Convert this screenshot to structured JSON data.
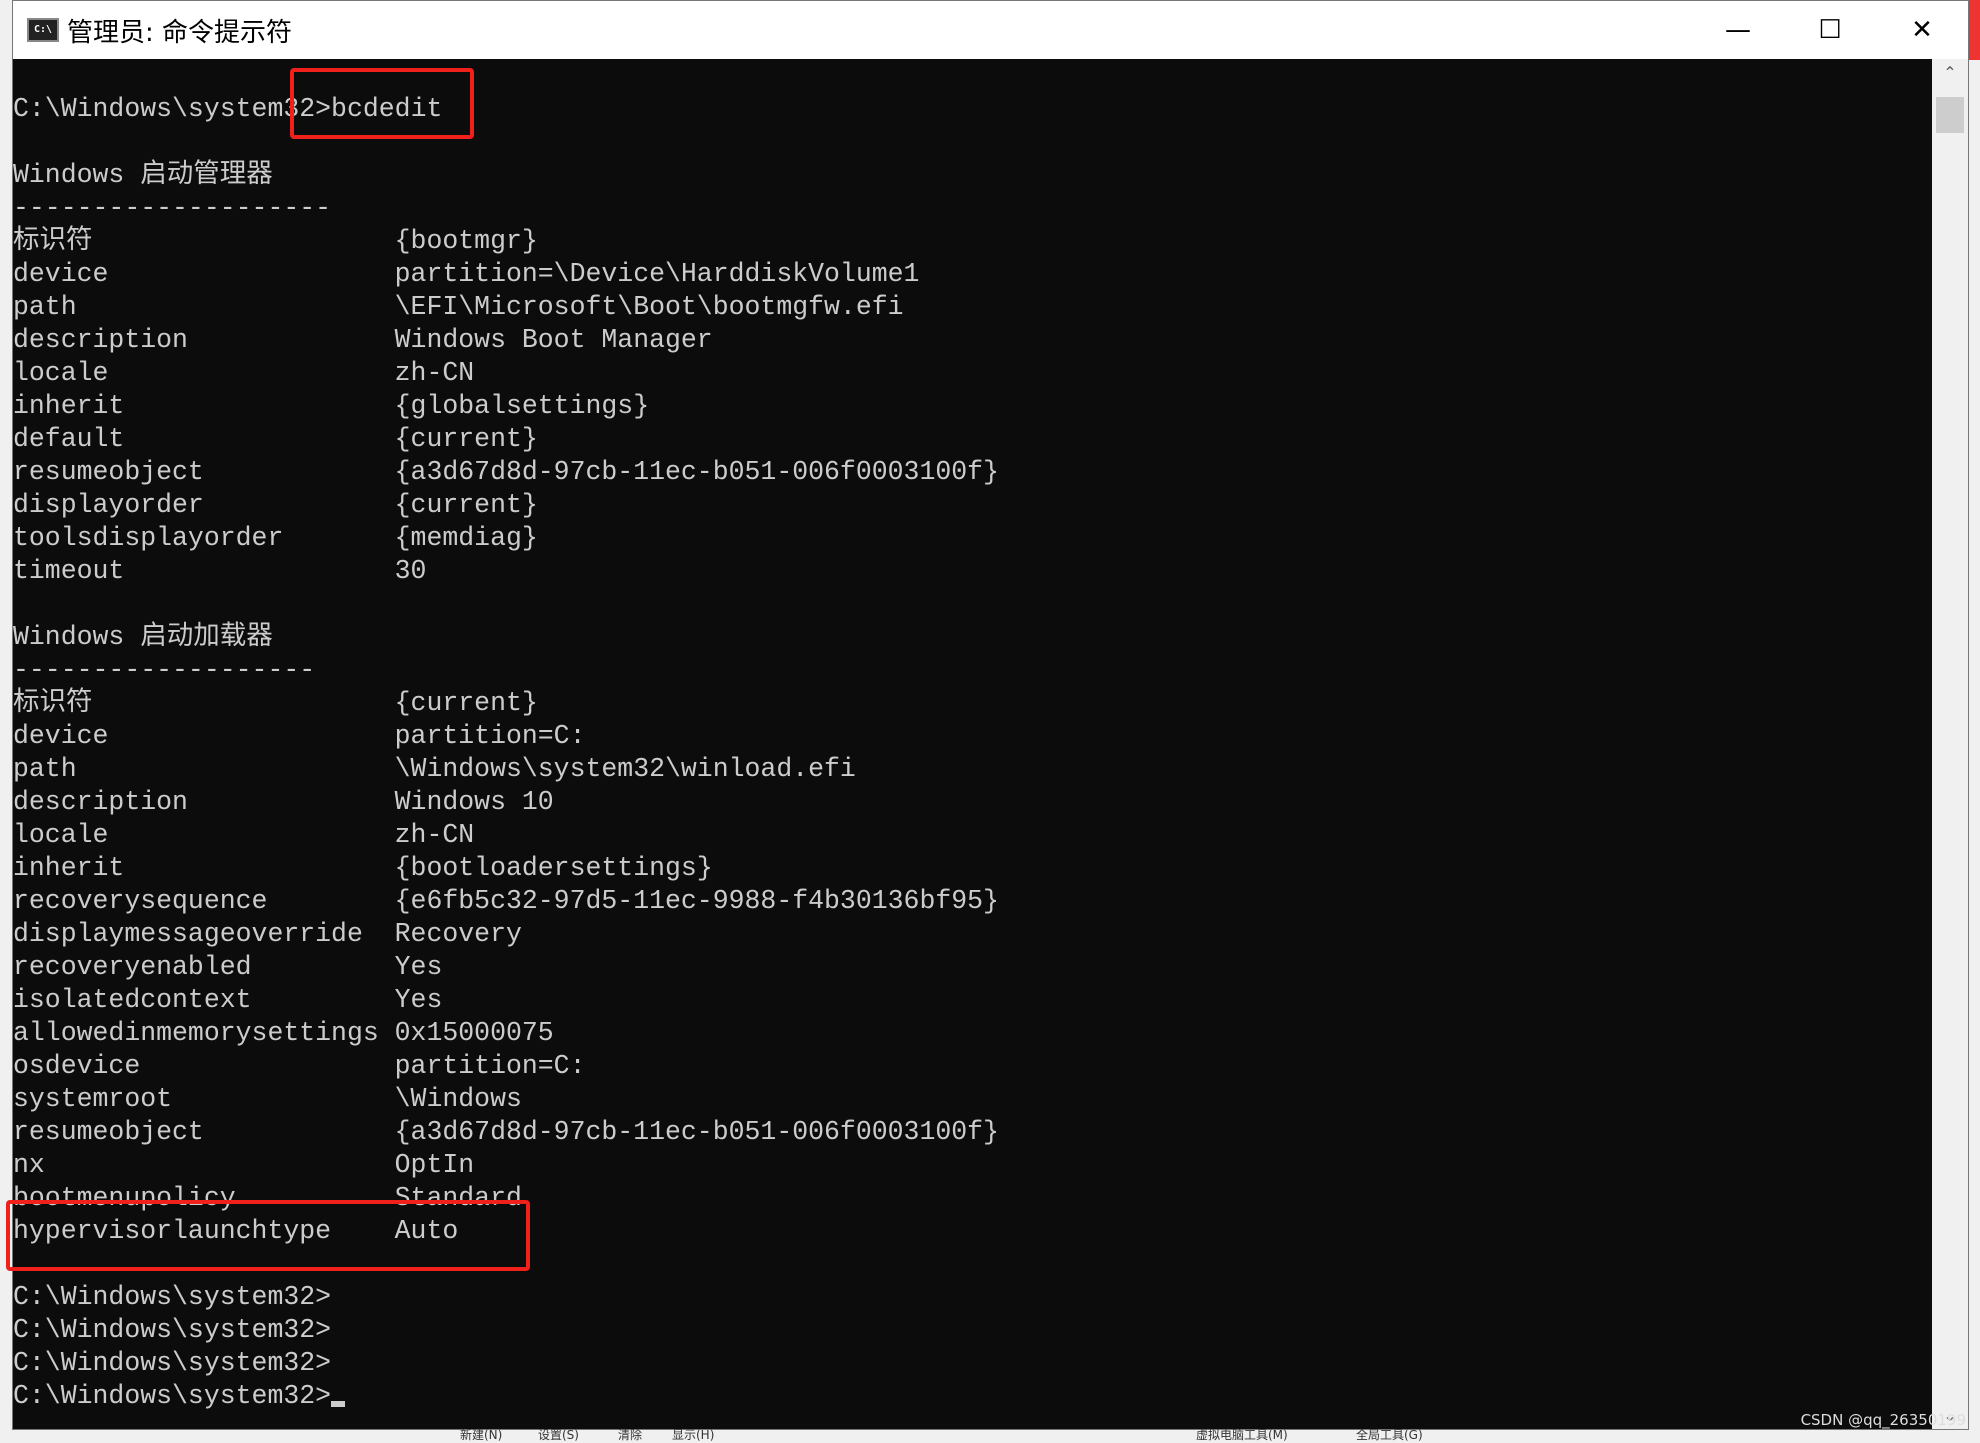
{
  "window": {
    "title": "管理员: 命令提示符",
    "icon": "cmd-icon",
    "controls": [
      "minimize",
      "maximize",
      "close"
    ]
  },
  "console": {
    "lines": [
      {
        "t": "C:\\Windows\\system32>bcdedit"
      },
      {
        "t": ""
      },
      {
        "t": "Windows 启动管理器"
      },
      {
        "t": "--------------------"
      },
      {
        "k": "标识符",
        "v": "{bootmgr}"
      },
      {
        "k": "device",
        "v": "partition=\\Device\\HarddiskVolume1"
      },
      {
        "k": "path",
        "v": "\\EFI\\Microsoft\\Boot\\bootmgfw.efi"
      },
      {
        "k": "description",
        "v": "Windows Boot Manager"
      },
      {
        "k": "locale",
        "v": "zh-CN"
      },
      {
        "k": "inherit",
        "v": "{globalsettings}"
      },
      {
        "k": "default",
        "v": "{current}"
      },
      {
        "k": "resumeobject",
        "v": "{a3d67d8d-97cb-11ec-b051-006f0003100f}"
      },
      {
        "k": "displayorder",
        "v": "{current}"
      },
      {
        "k": "toolsdisplayorder",
        "v": "{memdiag}"
      },
      {
        "k": "timeout",
        "v": "30"
      },
      {
        "t": ""
      },
      {
        "t": "Windows 启动加载器"
      },
      {
        "t": "-------------------"
      },
      {
        "k": "标识符",
        "v": "{current}"
      },
      {
        "k": "device",
        "v": "partition=C:"
      },
      {
        "k": "path",
        "v": "\\Windows\\system32\\winload.efi"
      },
      {
        "k": "description",
        "v": "Windows 10"
      },
      {
        "k": "locale",
        "v": "zh-CN"
      },
      {
        "k": "inherit",
        "v": "{bootloadersettings}"
      },
      {
        "k": "recoverysequence",
        "v": "{e6fb5c32-97d5-11ec-9988-f4b30136bf95}"
      },
      {
        "k": "displaymessageoverride",
        "v": "Recovery"
      },
      {
        "k": "recoveryenabled",
        "v": "Yes"
      },
      {
        "k": "isolatedcontext",
        "v": "Yes"
      },
      {
        "k": "allowedinmemorysettings",
        "v": "0x15000075"
      },
      {
        "k": "osdevice",
        "v": "partition=C:"
      },
      {
        "k": "systemroot",
        "v": "\\Windows"
      },
      {
        "k": "resumeobject",
        "v": "{a3d67d8d-97cb-11ec-b051-006f0003100f}"
      },
      {
        "k": "nx",
        "v": "OptIn"
      },
      {
        "k": "bootmenupolicy",
        "v": "Standard"
      },
      {
        "k": "hypervisorlaunchtype",
        "v": "Auto"
      },
      {
        "t": ""
      },
      {
        "t": "C:\\Windows\\system32>"
      },
      {
        "t": "C:\\Windows\\system32>"
      },
      {
        "t": "C:\\Windows\\system32>"
      },
      {
        "t": "C:\\Windows\\system32>",
        "cursor": true
      }
    ]
  },
  "highlight_color": "#f0201a",
  "background_menu": [
    "新建(N)",
    "设置(S)",
    "清除",
    "显示(H)",
    "虚拟电脑工具(M)",
    "全局工具(G)"
  ],
  "watermark": "CSDN @qq_26350199"
}
